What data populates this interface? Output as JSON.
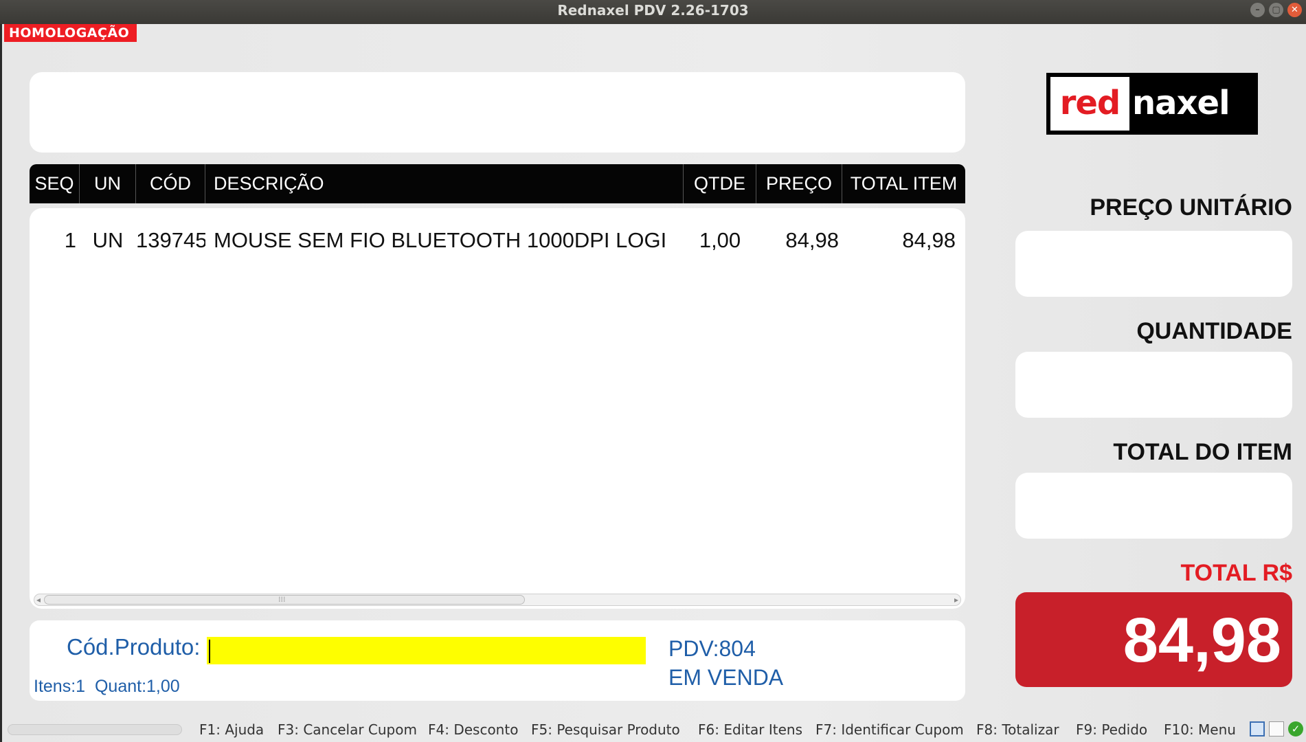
{
  "window": {
    "title": "Rednaxel PDV 2.26-1703",
    "controls": [
      "–",
      "▢",
      "✕"
    ]
  },
  "env_badge": "HOMOLOGAÇÃO",
  "grid": {
    "columns": [
      "SEQ",
      "UN",
      "CÓD",
      "DESCRIÇÃO",
      "QTDE",
      "PREÇO",
      "TOTAL ITEM"
    ],
    "rows": [
      {
        "seq": "1",
        "un": "UN",
        "cod": "139745",
        "descricao": "MOUSE SEM FIO BLUETOOTH 1000DPI LOGI",
        "qtde": "1,00",
        "preco": "84,98",
        "total": "84,98"
      }
    ]
  },
  "entry": {
    "cod_label": "Cód.Produto:",
    "cod_value": "",
    "pdv": "PDV:804",
    "status": "EM VENDA",
    "itens": "Itens:1",
    "quant": "Quant:1,00"
  },
  "logo": {
    "part1": "red",
    "part2": "naxel"
  },
  "side": {
    "preco_unitario_label": "PREÇO UNITÁRIO",
    "quantidade_label": "QUANTIDADE",
    "total_item_label": "TOTAL DO ITEM",
    "total_label": "TOTAL R$",
    "total_value": "84,98"
  },
  "fkeys": [
    "F1: Ajuda",
    "F3: Cancelar Cupom",
    "F4: Desconto",
    "F5: Pesquisar Produto",
    "F6: Editar Itens",
    "F7: Identificar Cupom",
    "F8: Totalizar",
    "F9: Pedido",
    "F10: Menu"
  ],
  "colors": {
    "accent_red": "#e31c23",
    "total_box": "#c8202a",
    "input_highlight": "#fefe00",
    "text_blue": "#1f5ea8"
  }
}
